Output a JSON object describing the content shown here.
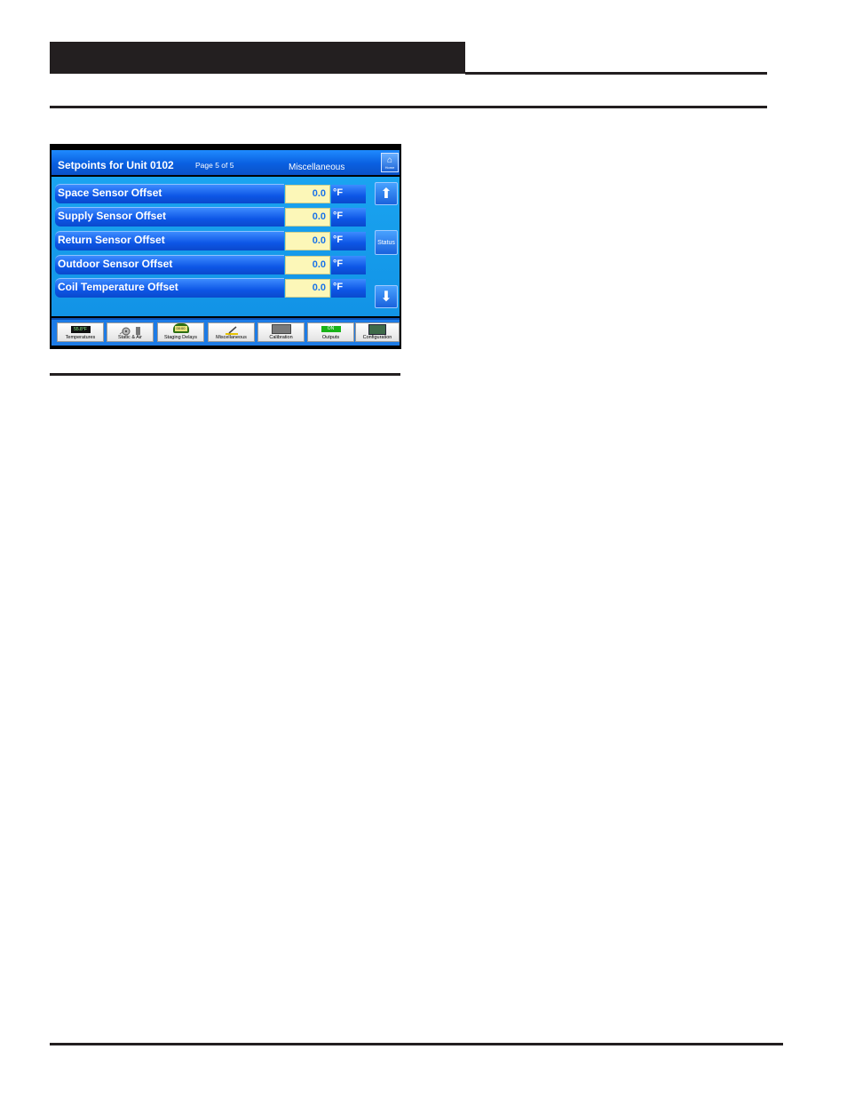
{
  "screen": {
    "title": "Setpoints for Unit 0102",
    "page_indicator": "Page 5 of 5",
    "section": "Miscellaneous",
    "home_label": "Home",
    "rows": [
      {
        "label": "Space Sensor Offset",
        "value": "0.0",
        "unit": "°F"
      },
      {
        "label": "Supply Sensor Offset",
        "value": "0.0",
        "unit": "°F"
      },
      {
        "label": "Return Sensor Offset",
        "value": "0.0",
        "unit": "°F"
      },
      {
        "label": "Outdoor Sensor Offset",
        "value": "0.0",
        "unit": "°F"
      },
      {
        "label": "Coil Temperature Offset",
        "value": "0.0",
        "unit": "°F"
      }
    ],
    "side": {
      "up": "⬆",
      "status": "Status",
      "down": "⬇"
    },
    "tabs": [
      {
        "label": "Temperatures",
        "thumb_text": "55.8°F"
      },
      {
        "label": "Static & Air",
        "thumb_text": ""
      },
      {
        "label": "Staging Delays",
        "thumb_text": "00:00"
      },
      {
        "label": "Miscellaneous",
        "thumb_text": ""
      },
      {
        "label": "Calibration",
        "thumb_text": ""
      },
      {
        "label": "Outputs",
        "thumb_text": "ON"
      },
      {
        "label": "Configuration",
        "thumb_text": ""
      }
    ]
  },
  "colors": {
    "title_blue": "#0a5fe0",
    "body_blue": "#1293e6",
    "value_bg": "#fcf7b8",
    "value_text": "#1a73e8"
  }
}
